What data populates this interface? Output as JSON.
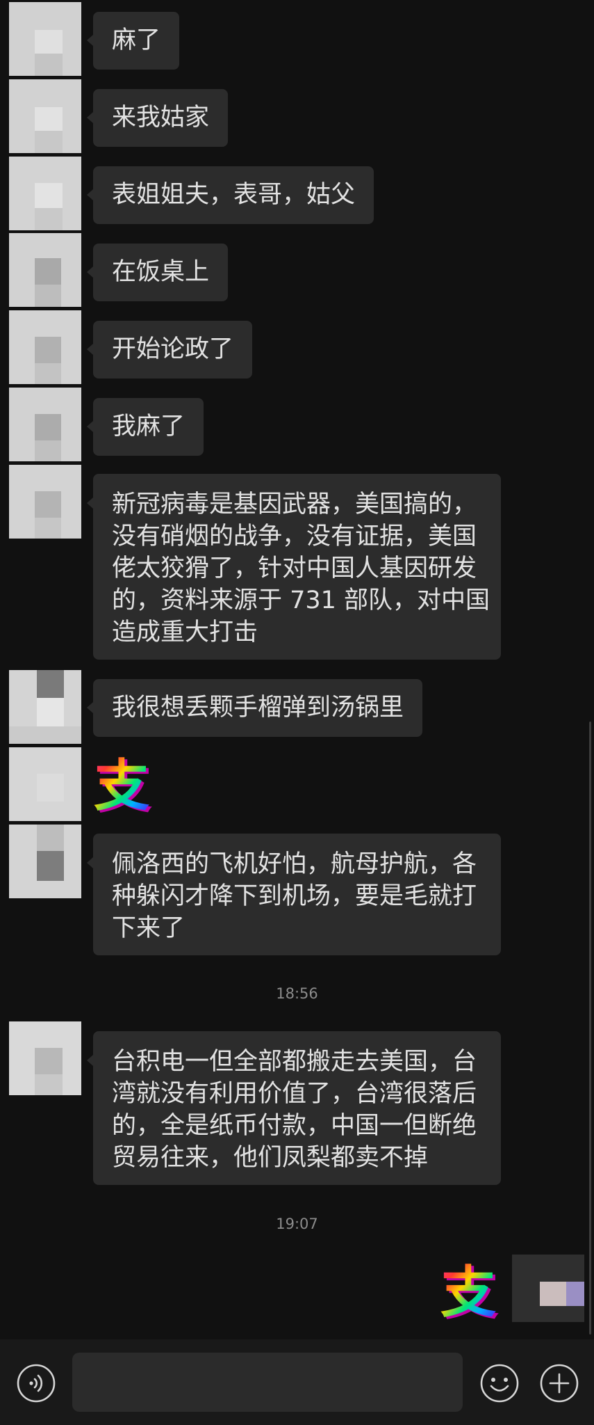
{
  "theme": {
    "page_bg": "#111111",
    "bubble_bg": "#2c2c2c",
    "text": "#e2e2e2",
    "timestamp": "#8c8c8c",
    "bar_bg": "#191919"
  },
  "messages": [
    {
      "lines": [
        "麻了"
      ]
    },
    {
      "lines": [
        "来我姑家"
      ]
    },
    {
      "lines": [
        "表姐姐夫，表哥，姑父"
      ]
    },
    {
      "lines": [
        "在饭桌上"
      ]
    },
    {
      "lines": [
        "开始论政了"
      ]
    },
    {
      "lines": [
        "我麻了"
      ]
    },
    {
      "lines": [
        "新冠病毒是基因武器，美国搞的，",
        "没有硝烟的战争，没有证据，美国",
        "佬太狡猾了，针对中国人基因研发",
        "的，资料来源于 731 部队，对中国",
        "造成重大打击"
      ]
    },
    {
      "lines": [
        "我很想丢颗手榴弹到汤锅里"
      ]
    },
    {
      "sticker": "支"
    },
    {
      "lines": [
        "佩洛西的飞机好怕，航母护航，各",
        "种躲闪才降下到机场，要是毛就打",
        "下来了"
      ]
    },
    {
      "time": "18:56"
    },
    {
      "lines": [
        "台积电一但全部都搬走去美国，台",
        "湾就没有利用价值了，台湾很落后",
        "的，全是纸币付款，中国一但断绝",
        "贸易往来，他们凤梨都卖不掉"
      ]
    },
    {
      "time": "19:07"
    }
  ],
  "outgoing": [
    {
      "sticker": "支"
    }
  ],
  "input_bar": {
    "voice_icon": "voice-icon",
    "input_value": "",
    "emoji_icon": "emoji-icon",
    "plus_icon": "plus-icon"
  }
}
